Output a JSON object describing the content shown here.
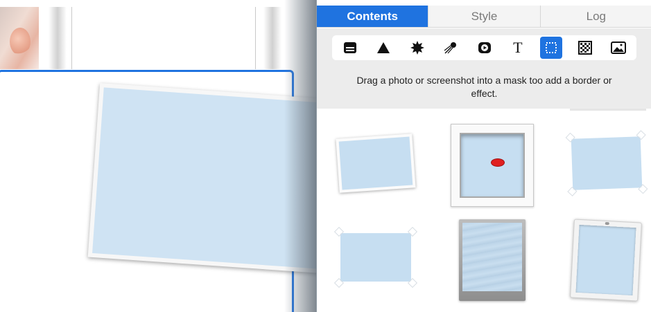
{
  "tabs": [
    {
      "label": "Contents",
      "active": true
    },
    {
      "label": "Style",
      "active": false
    },
    {
      "label": "Log",
      "active": false
    }
  ],
  "toolbar": {
    "tools": [
      {
        "icon": "layers-icon"
      },
      {
        "icon": "triangle-icon"
      },
      {
        "icon": "starburst-icon"
      },
      {
        "icon": "comet-icon"
      },
      {
        "icon": "play-button-icon"
      },
      {
        "icon": "text-icon",
        "glyph": "T"
      },
      {
        "icon": "mask-frame-icon",
        "selected": true
      },
      {
        "icon": "checkerboard-icon"
      },
      {
        "icon": "image-icon"
      }
    ]
  },
  "hint": {
    "text": "Drag a photo or screenshot into a mask too add a border or effect."
  },
  "colors": {
    "accent": "#1f73e0",
    "mask_fill": "#c6def1",
    "toolbar_bg": "#ececec"
  },
  "masks": [
    {
      "icon": "tilted-photo-mask"
    },
    {
      "icon": "shadow-box-frame-mask"
    },
    {
      "icon": "taped-photo-mask"
    },
    {
      "icon": "taped-flat-mask"
    },
    {
      "icon": "wavy-metal-frame-mask"
    },
    {
      "icon": "pinned-frame-mask"
    }
  ]
}
